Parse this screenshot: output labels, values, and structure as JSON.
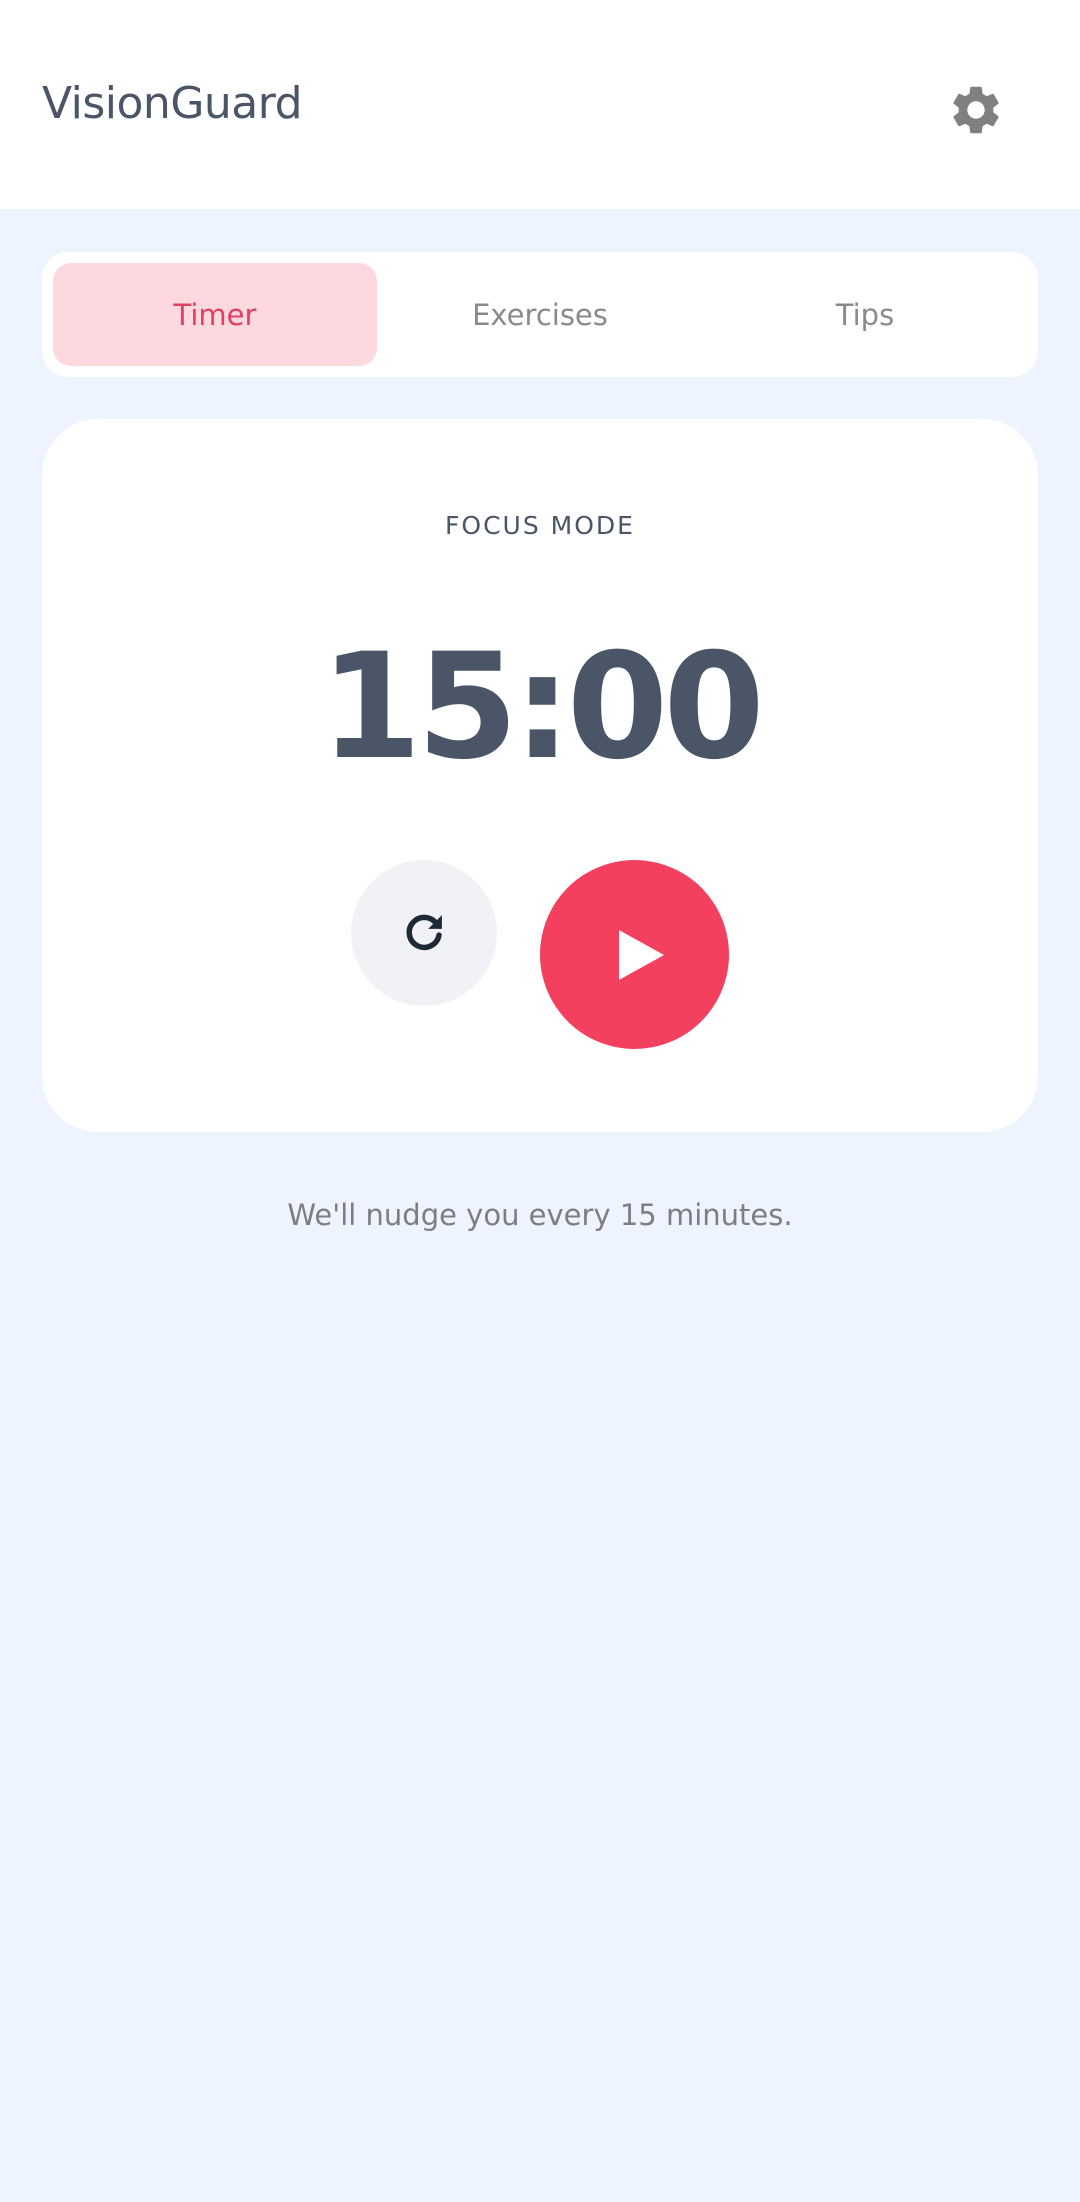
{
  "header": {
    "title": "VisionGuard",
    "settings_icon": "gear-icon"
  },
  "tabs": [
    {
      "label": "Timer",
      "active": true
    },
    {
      "label": "Exercises",
      "active": false
    },
    {
      "label": "Tips",
      "active": false
    }
  ],
  "timer": {
    "mode_label": "FOCUS MODE",
    "time": "15:00",
    "reset_icon": "refresh-icon",
    "play_icon": "play-icon"
  },
  "footer": {
    "nudge_text": "We'll nudge you every 15 minutes."
  },
  "colors": {
    "accent": "#f4405f",
    "active_tab_bg": "#fdd8df",
    "active_tab_text": "#e04062",
    "background": "#eef4fd",
    "text_dark": "#4a5568"
  }
}
